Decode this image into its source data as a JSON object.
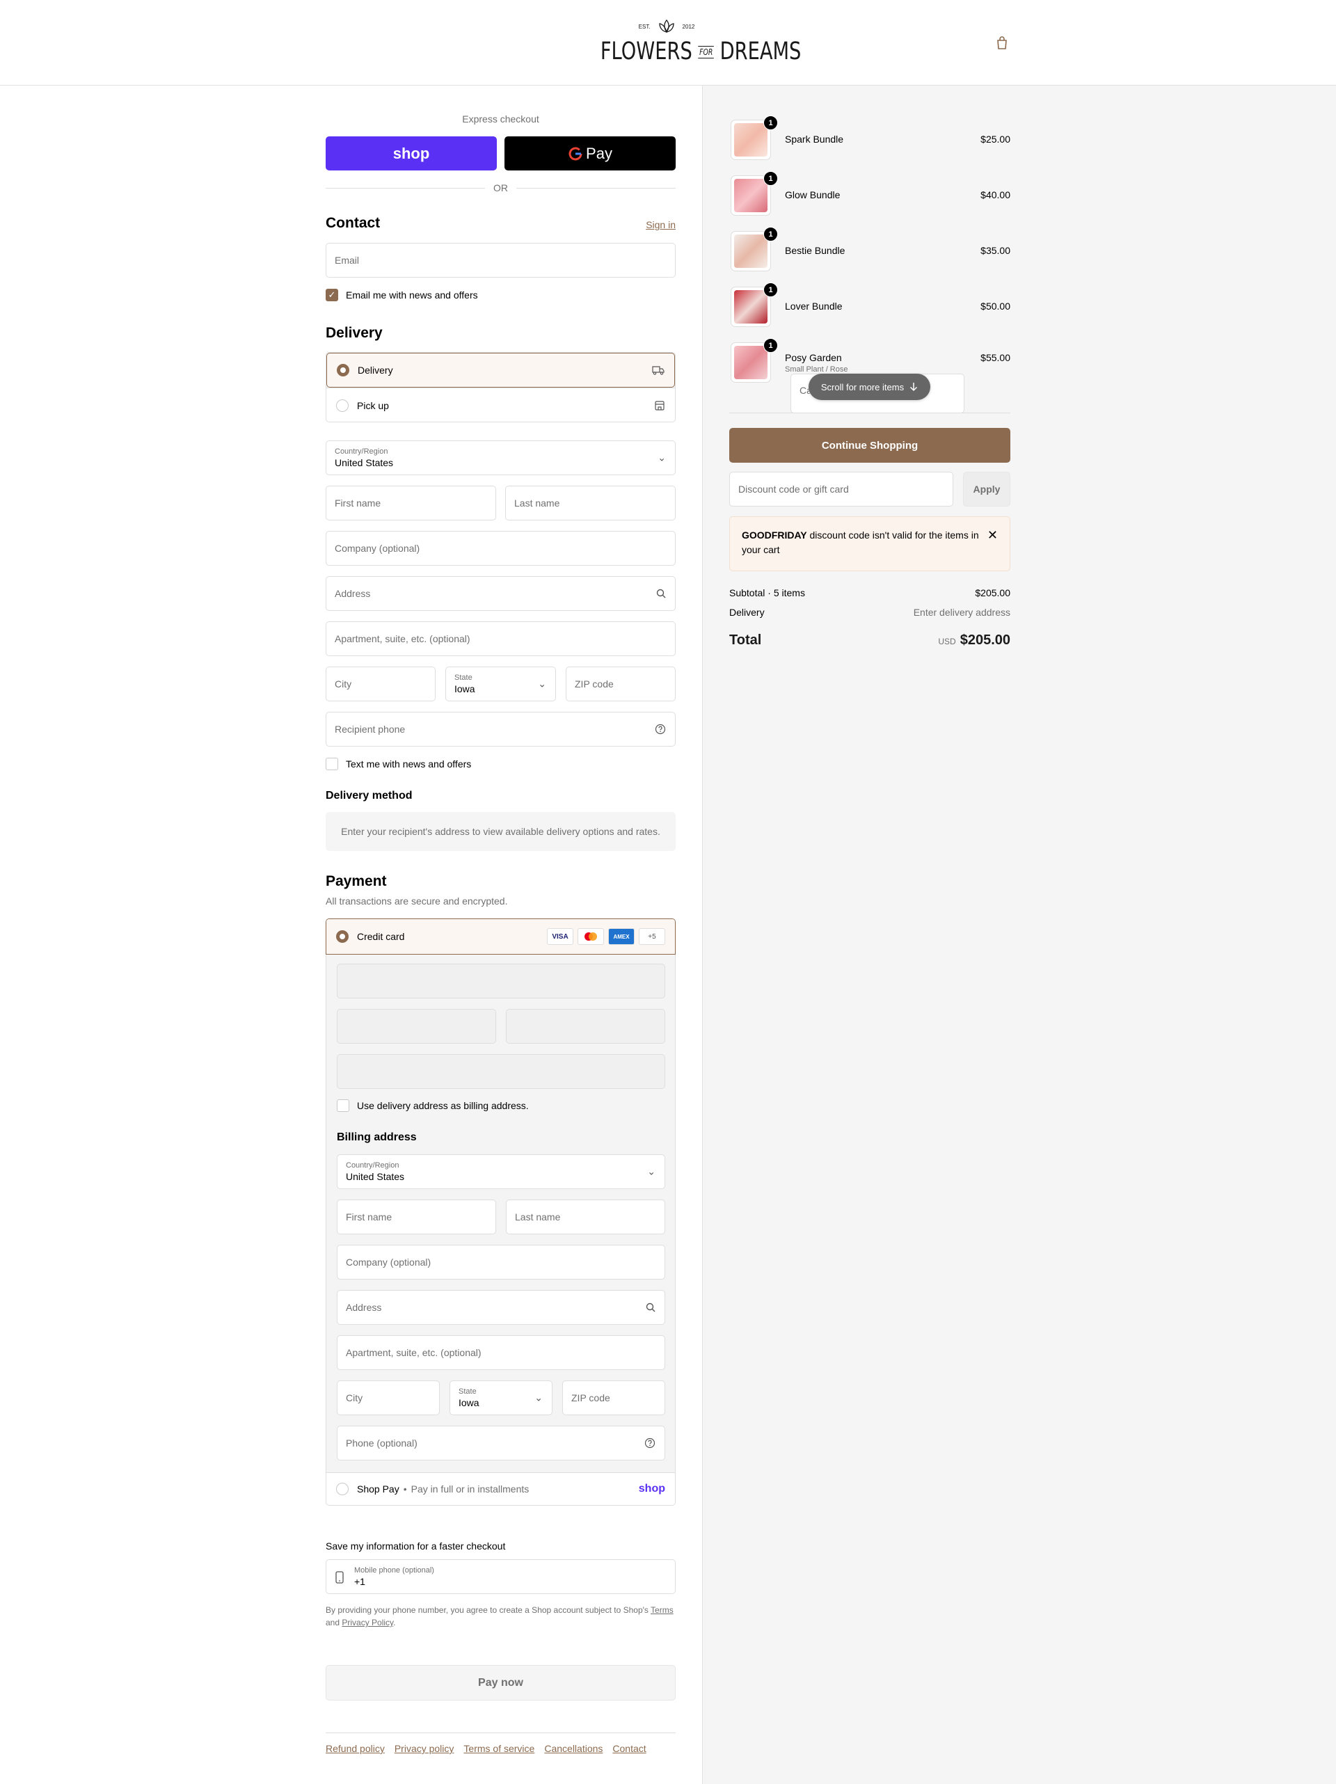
{
  "brand": {
    "est": "EST.",
    "year": "2012",
    "name_left": "FLOWERS",
    "name_mid": "FOR",
    "name_right": "DREAMS"
  },
  "colors": {
    "accent": "#8b6a4f",
    "shop_purple": "#5a31f4",
    "alert_bg": "#fcf3ec"
  },
  "express": {
    "label": "Express checkout",
    "shop": "shop",
    "gpay": "Pay",
    "or": "OR"
  },
  "contact": {
    "title": "Contact",
    "sign_in": "Sign in",
    "email_placeholder": "Email",
    "news_label": "Email me with news and offers",
    "news_checked": true
  },
  "delivery": {
    "title": "Delivery",
    "options": [
      {
        "label": "Delivery",
        "selected": true,
        "icon": "truck-icon"
      },
      {
        "label": "Pick up",
        "selected": false,
        "icon": "store-icon"
      }
    ],
    "country_label": "Country/Region",
    "country_value": "United States",
    "first_name": "First name",
    "last_name": "Last name",
    "company": "Company (optional)",
    "address": "Address",
    "apartment": "Apartment, suite, etc. (optional)",
    "city": "City",
    "state_label": "State",
    "state_value": "Iowa",
    "zip": "ZIP code",
    "phone": "Recipient phone",
    "text_label": "Text me with news and offers"
  },
  "delivery_method": {
    "title": "Delivery method",
    "note": "Enter your recipient's address to view available delivery options and rates."
  },
  "payment": {
    "title": "Payment",
    "subtitle": "All transactions are secure and encrypted.",
    "credit_card": "Credit card",
    "cards": [
      "VISA",
      "MC",
      "AMEX",
      "+5"
    ],
    "use_delivery_label": "Use delivery address as billing address.",
    "billing_title": "Billing address",
    "billing": {
      "country_label": "Country/Region",
      "country_value": "United States",
      "first_name": "First name",
      "last_name": "Last name",
      "company": "Company (optional)",
      "address": "Address",
      "apartment": "Apartment, suite, etc. (optional)",
      "city": "City",
      "state_label": "State",
      "state_value": "Iowa",
      "zip": "ZIP code",
      "phone": "Phone (optional)"
    },
    "shop_pay": "Shop Pay",
    "shop_pay_note": "Pay in full or in installments",
    "shop_logo": "shop"
  },
  "save_info": {
    "title": "Save my information for a faster checkout",
    "mobile_label": "Mobile phone (optional)",
    "mobile_value": "+1",
    "note_prefix": "By providing your phone number, you agree to create a Shop account subject to Shop's",
    "terms": "Terms",
    "and": "and",
    "privacy": "Privacy Policy",
    "period": "."
  },
  "pay_now": "Pay now",
  "footer_links": [
    "Refund policy",
    "Privacy policy",
    "Terms of service",
    "Cancellations",
    "Contact"
  ],
  "cart": {
    "items": [
      {
        "name": "Spark Bundle",
        "price": "$25.00",
        "qty": "1",
        "variant": ""
      },
      {
        "name": "Glow Bundle",
        "price": "$40.00",
        "qty": "1",
        "variant": ""
      },
      {
        "name": "Bestie Bundle",
        "price": "$35.00",
        "qty": "1",
        "variant": ""
      },
      {
        "name": "Lover Bundle",
        "price": "$50.00",
        "qty": "1",
        "variant": ""
      },
      {
        "name": "Posy Garden",
        "price": "$55.00",
        "qty": "1",
        "variant": "Small Plant / Rose"
      }
    ],
    "partial_text": "Ca",
    "scroll_hint": "Scroll for more items",
    "continue": "Continue Shopping",
    "discount_placeholder": "Discount code or gift card",
    "apply": "Apply",
    "alert_code": "GOODFRIDAY",
    "alert_text": "discount code isn't valid for the items in your cart",
    "subtotal_label": "Subtotal · 5 items",
    "subtotal_value": "$205.00",
    "delivery_label": "Delivery",
    "delivery_value": "Enter delivery address",
    "total_label": "Total",
    "currency": "USD",
    "total_value": "$205.00"
  }
}
